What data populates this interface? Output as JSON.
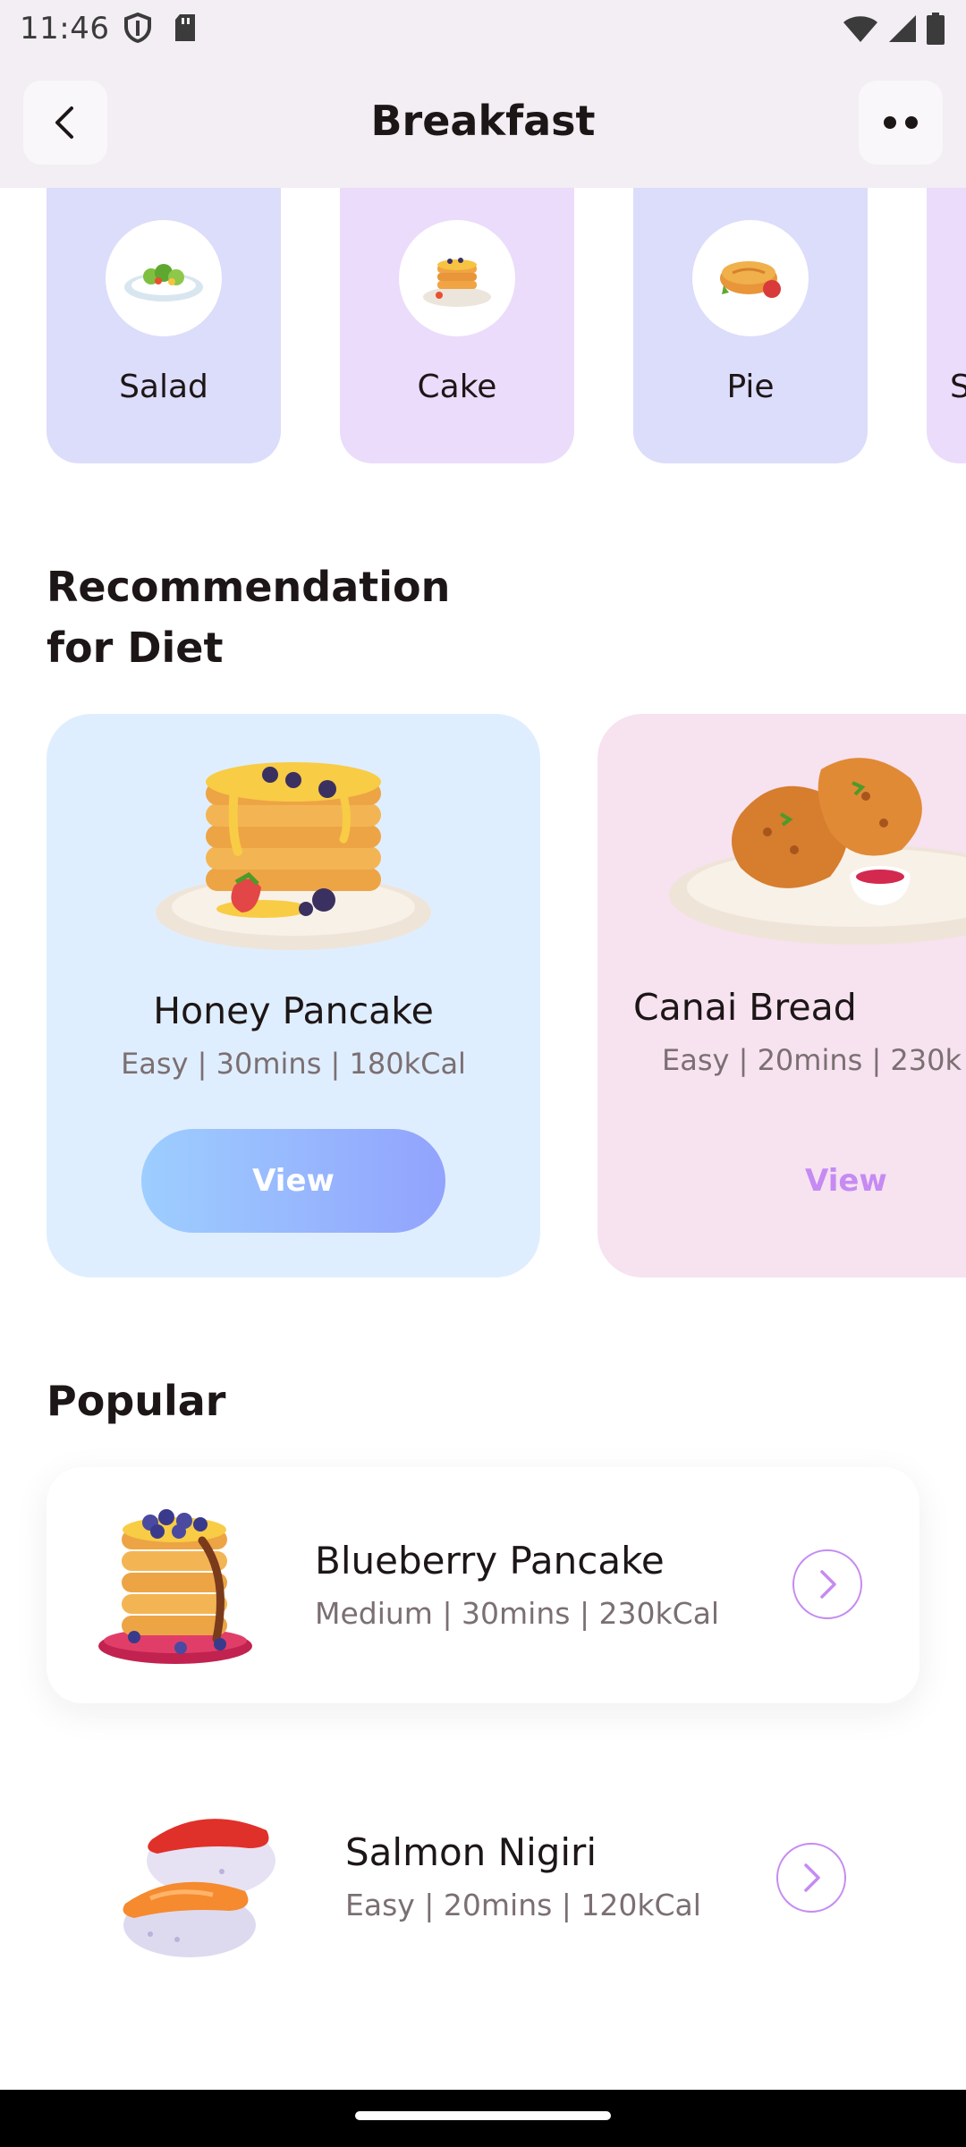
{
  "status_bar": {
    "time": "11:46"
  },
  "header": {
    "title": "Breakfast"
  },
  "categories": [
    {
      "label": "Salad"
    },
    {
      "label": "Cake"
    },
    {
      "label": "Pie"
    },
    {
      "label": "S"
    }
  ],
  "recommendation": {
    "title_line1": "Recommendation",
    "title_line2": "for Diet",
    "cards": [
      {
        "name": "Honey Pancake",
        "meta": "Easy | 30mins | 180kCal",
        "button": "View"
      },
      {
        "name": "Canai Bread",
        "meta": "Easy | 20mins | 230k",
        "button": "View"
      }
    ]
  },
  "popular": {
    "title": "Popular",
    "items": [
      {
        "name": "Blueberry Pancake",
        "meta": "Medium | 30mins | 230kCal"
      },
      {
        "name": "Salmon Nigiri",
        "meta": "Easy | 20mins | 120kCal"
      }
    ]
  },
  "colors": {
    "brand_purple": "#c58bf2",
    "brand_blue_start": "#9dceff",
    "brand_blue_end": "#92a3fd",
    "card_blue": "#dfeefe",
    "card_pink": "#f7e2f0",
    "category_blue": "#dcdcfb",
    "category_purple": "#ebdcfb"
  },
  "icons": [
    "shield-icon",
    "sd-card-icon",
    "wifi-icon",
    "signal-icon",
    "battery-icon",
    "back-chevron-icon",
    "more-dots-icon",
    "chevron-right-icon"
  ]
}
